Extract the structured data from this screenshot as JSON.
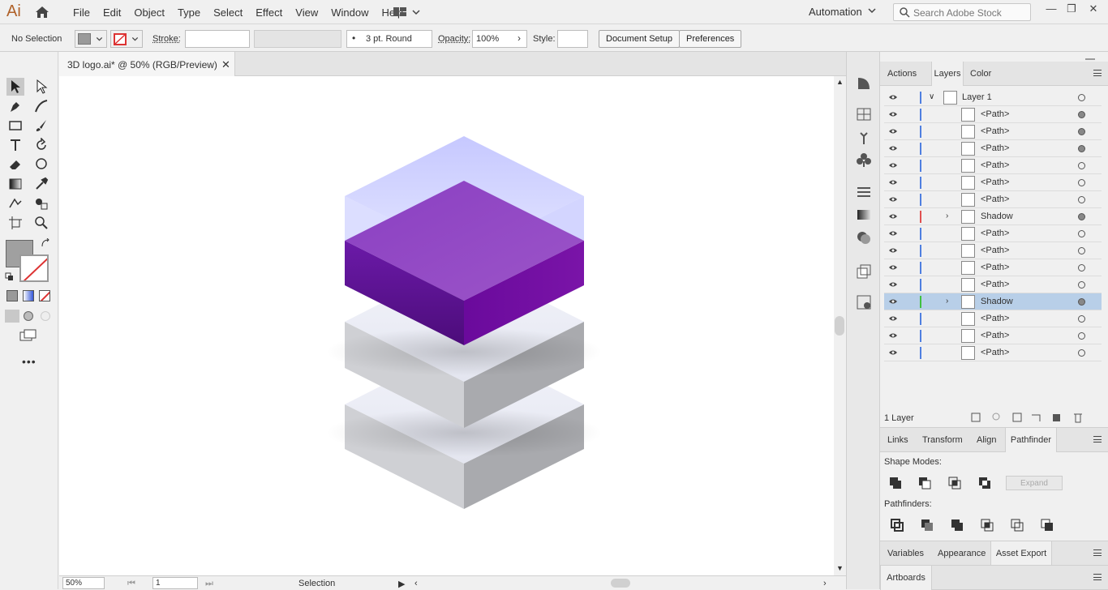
{
  "app": {
    "logo": "Ai"
  },
  "menu": [
    "File",
    "Edit",
    "Object",
    "Type",
    "Select",
    "Effect",
    "View",
    "Window",
    "Help"
  ],
  "workspace": "Automation",
  "search": {
    "placeholder": "Search Adobe Stock"
  },
  "control": {
    "selection": "No Selection",
    "stroke_label": "Stroke:",
    "brush": "3 pt. Round",
    "opacity_label": "Opacity:",
    "opacity_value": "100%",
    "style_label": "Style:",
    "doc_setup": "Document Setup",
    "preferences": "Preferences"
  },
  "document": {
    "tab": "3D logo.ai* @ 50% (RGB/Preview)"
  },
  "status": {
    "zoom": "50%",
    "artboard": "1",
    "tool": "Selection"
  },
  "layers_panel": {
    "tabs": [
      "Actions",
      "Layers",
      "Color"
    ],
    "active_tab": "Layers",
    "rows": [
      {
        "name": "Layer 1",
        "type": "layer",
        "target": "empty"
      },
      {
        "name": "<Path>",
        "type": "path",
        "target": "filled"
      },
      {
        "name": "<Path>",
        "type": "path",
        "target": "filled"
      },
      {
        "name": "<Path>",
        "type": "path",
        "target": "filled"
      },
      {
        "name": "<Path>",
        "type": "path",
        "target": "empty"
      },
      {
        "name": "<Path>",
        "type": "path",
        "target": "empty"
      },
      {
        "name": "<Path>",
        "type": "path",
        "target": "empty"
      },
      {
        "name": "Shadow",
        "type": "group",
        "target": "filled",
        "bar": "#e05050"
      },
      {
        "name": "<Path>",
        "type": "path",
        "target": "empty"
      },
      {
        "name": "<Path>",
        "type": "path",
        "target": "empty"
      },
      {
        "name": "<Path>",
        "type": "path",
        "target": "empty"
      },
      {
        "name": "<Path>",
        "type": "path",
        "target": "empty"
      },
      {
        "name": "Shadow",
        "type": "group",
        "target": "filled",
        "bar": "#40c040",
        "selected": true
      },
      {
        "name": "<Path>",
        "type": "path",
        "target": "empty"
      },
      {
        "name": "<Path>",
        "type": "path",
        "target": "empty"
      },
      {
        "name": "<Path>",
        "type": "path",
        "target": "empty"
      }
    ],
    "footer": "1 Layer"
  },
  "pathfinder_panel": {
    "tabs": [
      "Links",
      "Transform",
      "Align",
      "Pathfinder"
    ],
    "active_tab": "Pathfinder",
    "shape_modes_label": "Shape Modes:",
    "expand": "Expand",
    "pathfinders_label": "Pathfinders:"
  },
  "bottom_panel": {
    "tabs": [
      "Variables",
      "Appearance",
      "Asset Export"
    ],
    "active_tab": "Asset Export"
  },
  "artboards_panel": {
    "tabs": [
      "Artboards"
    ]
  },
  "colors": {
    "accent": "#6a1b9a",
    "selection": "#b8cfe8",
    "layer_bar": "#4f7fe0"
  }
}
